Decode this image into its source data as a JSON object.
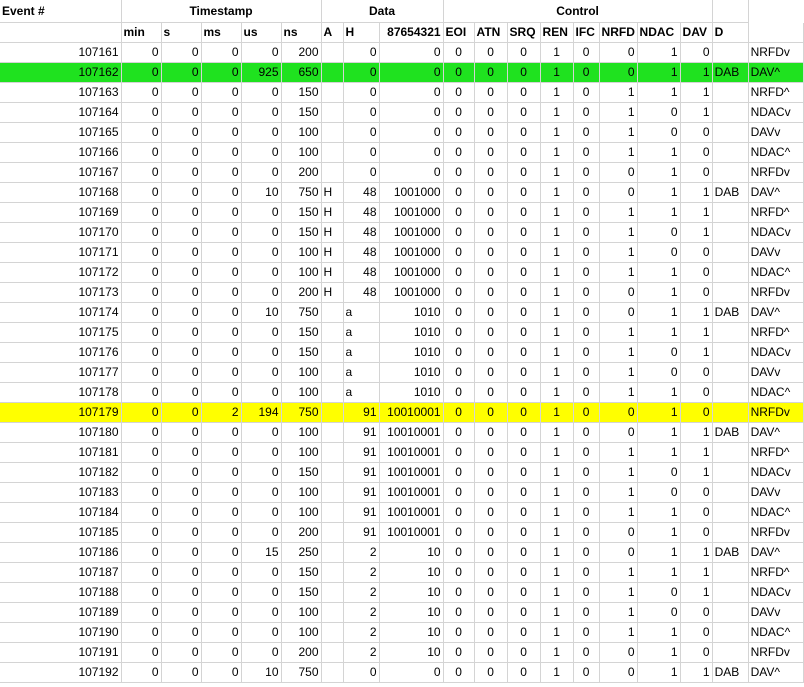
{
  "headers": {
    "event": "Event #",
    "timestamp": "Timestamp",
    "data": "Data",
    "control": "Control",
    "sub": [
      "min",
      "s",
      "ms",
      "us",
      "ns",
      "A",
      "H",
      "87654321",
      "EOI",
      "ATN",
      "SRQ",
      "REN",
      "IFC",
      "NRFD",
      "NDAC",
      "DAV",
      "D",
      ""
    ]
  },
  "colors": {
    "green_highlight": "#1fe21f",
    "yellow_highlight": "#ffff00",
    "gridline": "#d4d4d4"
  },
  "rows": [
    {
      "event": "107161",
      "min": "0",
      "s": "0",
      "ms": "0",
      "us": "0",
      "ns": "200",
      "a": "",
      "h": "0",
      "bits": "0",
      "eoi": "0",
      "atn": "0",
      "srq": "0",
      "ren": "1",
      "ifc": "0",
      "nrfd": "0",
      "ndac": "1",
      "dav": "0",
      "d": "",
      "desc": "NRFDv",
      "hl": ""
    },
    {
      "event": "107162",
      "min": "0",
      "s": "0",
      "ms": "0",
      "us": "925",
      "ns": "650",
      "a": "",
      "h": "0",
      "bits": "0",
      "eoi": "0",
      "atn": "0",
      "srq": "0",
      "ren": "1",
      "ifc": "0",
      "nrfd": "0",
      "ndac": "1",
      "dav": "1",
      "d": "DAB",
      "desc": "DAV^",
      "hl": "green"
    },
    {
      "event": "107163",
      "min": "0",
      "s": "0",
      "ms": "0",
      "us": "0",
      "ns": "150",
      "a": "",
      "h": "0",
      "bits": "0",
      "eoi": "0",
      "atn": "0",
      "srq": "0",
      "ren": "1",
      "ifc": "0",
      "nrfd": "1",
      "ndac": "1",
      "dav": "1",
      "d": "",
      "desc": "NRFD^",
      "hl": ""
    },
    {
      "event": "107164",
      "min": "0",
      "s": "0",
      "ms": "0",
      "us": "0",
      "ns": "150",
      "a": "",
      "h": "0",
      "bits": "0",
      "eoi": "0",
      "atn": "0",
      "srq": "0",
      "ren": "1",
      "ifc": "0",
      "nrfd": "1",
      "ndac": "0",
      "dav": "1",
      "d": "",
      "desc": "NDACv",
      "hl": ""
    },
    {
      "event": "107165",
      "min": "0",
      "s": "0",
      "ms": "0",
      "us": "0",
      "ns": "100",
      "a": "",
      "h": "0",
      "bits": "0",
      "eoi": "0",
      "atn": "0",
      "srq": "0",
      "ren": "1",
      "ifc": "0",
      "nrfd": "1",
      "ndac": "0",
      "dav": "0",
      "d": "",
      "desc": "DAVv",
      "hl": ""
    },
    {
      "event": "107166",
      "min": "0",
      "s": "0",
      "ms": "0",
      "us": "0",
      "ns": "100",
      "a": "",
      "h": "0",
      "bits": "0",
      "eoi": "0",
      "atn": "0",
      "srq": "0",
      "ren": "1",
      "ifc": "0",
      "nrfd": "1",
      "ndac": "1",
      "dav": "0",
      "d": "",
      "desc": "NDAC^",
      "hl": ""
    },
    {
      "event": "107167",
      "min": "0",
      "s": "0",
      "ms": "0",
      "us": "0",
      "ns": "200",
      "a": "",
      "h": "0",
      "bits": "0",
      "eoi": "0",
      "atn": "0",
      "srq": "0",
      "ren": "1",
      "ifc": "0",
      "nrfd": "0",
      "ndac": "1",
      "dav": "0",
      "d": "",
      "desc": "NRFDv",
      "hl": ""
    },
    {
      "event": "107168",
      "min": "0",
      "s": "0",
      "ms": "0",
      "us": "10",
      "ns": "750",
      "a": "H",
      "h": "48",
      "bits": "1001000",
      "eoi": "0",
      "atn": "0",
      "srq": "0",
      "ren": "1",
      "ifc": "0",
      "nrfd": "0",
      "ndac": "1",
      "dav": "1",
      "d": "DAB",
      "desc": "DAV^",
      "hl": ""
    },
    {
      "event": "107169",
      "min": "0",
      "s": "0",
      "ms": "0",
      "us": "0",
      "ns": "150",
      "a": "H",
      "h": "48",
      "bits": "1001000",
      "eoi": "0",
      "atn": "0",
      "srq": "0",
      "ren": "1",
      "ifc": "0",
      "nrfd": "1",
      "ndac": "1",
      "dav": "1",
      "d": "",
      "desc": "NRFD^",
      "hl": ""
    },
    {
      "event": "107170",
      "min": "0",
      "s": "0",
      "ms": "0",
      "us": "0",
      "ns": "150",
      "a": "H",
      "h": "48",
      "bits": "1001000",
      "eoi": "0",
      "atn": "0",
      "srq": "0",
      "ren": "1",
      "ifc": "0",
      "nrfd": "1",
      "ndac": "0",
      "dav": "1",
      "d": "",
      "desc": "NDACv",
      "hl": ""
    },
    {
      "event": "107171",
      "min": "0",
      "s": "0",
      "ms": "0",
      "us": "0",
      "ns": "100",
      "a": "H",
      "h": "48",
      "bits": "1001000",
      "eoi": "0",
      "atn": "0",
      "srq": "0",
      "ren": "1",
      "ifc": "0",
      "nrfd": "1",
      "ndac": "0",
      "dav": "0",
      "d": "",
      "desc": "DAVv",
      "hl": ""
    },
    {
      "event": "107172",
      "min": "0",
      "s": "0",
      "ms": "0",
      "us": "0",
      "ns": "100",
      "a": "H",
      "h": "48",
      "bits": "1001000",
      "eoi": "0",
      "atn": "0",
      "srq": "0",
      "ren": "1",
      "ifc": "0",
      "nrfd": "1",
      "ndac": "1",
      "dav": "0",
      "d": "",
      "desc": "NDAC^",
      "hl": ""
    },
    {
      "event": "107173",
      "min": "0",
      "s": "0",
      "ms": "0",
      "us": "0",
      "ns": "200",
      "a": "H",
      "h": "48",
      "bits": "1001000",
      "eoi": "0",
      "atn": "0",
      "srq": "0",
      "ren": "1",
      "ifc": "0",
      "nrfd": "0",
      "ndac": "1",
      "dav": "0",
      "d": "",
      "desc": "NRFDv",
      "hl": ""
    },
    {
      "event": "107174",
      "min": "0",
      "s": "0",
      "ms": "0",
      "us": "10",
      "ns": "750",
      "a": "",
      "h": "a",
      "bits": "1010",
      "eoi": "0",
      "atn": "0",
      "srq": "0",
      "ren": "1",
      "ifc": "0",
      "nrfd": "0",
      "ndac": "1",
      "dav": "1",
      "d": "DAB",
      "desc": "DAV^",
      "hl": ""
    },
    {
      "event": "107175",
      "min": "0",
      "s": "0",
      "ms": "0",
      "us": "0",
      "ns": "150",
      "a": "",
      "h": "a",
      "bits": "1010",
      "eoi": "0",
      "atn": "0",
      "srq": "0",
      "ren": "1",
      "ifc": "0",
      "nrfd": "1",
      "ndac": "1",
      "dav": "1",
      "d": "",
      "desc": "NRFD^",
      "hl": ""
    },
    {
      "event": "107176",
      "min": "0",
      "s": "0",
      "ms": "0",
      "us": "0",
      "ns": "150",
      "a": "",
      "h": "a",
      "bits": "1010",
      "eoi": "0",
      "atn": "0",
      "srq": "0",
      "ren": "1",
      "ifc": "0",
      "nrfd": "1",
      "ndac": "0",
      "dav": "1",
      "d": "",
      "desc": "NDACv",
      "hl": ""
    },
    {
      "event": "107177",
      "min": "0",
      "s": "0",
      "ms": "0",
      "us": "0",
      "ns": "100",
      "a": "",
      "h": "a",
      "bits": "1010",
      "eoi": "0",
      "atn": "0",
      "srq": "0",
      "ren": "1",
      "ifc": "0",
      "nrfd": "1",
      "ndac": "0",
      "dav": "0",
      "d": "",
      "desc": "DAVv",
      "hl": ""
    },
    {
      "event": "107178",
      "min": "0",
      "s": "0",
      "ms": "0",
      "us": "0",
      "ns": "100",
      "a": "",
      "h": "a",
      "bits": "1010",
      "eoi": "0",
      "atn": "0",
      "srq": "0",
      "ren": "1",
      "ifc": "0",
      "nrfd": "1",
      "ndac": "1",
      "dav": "0",
      "d": "",
      "desc": "NDAC^",
      "hl": ""
    },
    {
      "event": "107179",
      "min": "0",
      "s": "0",
      "ms": "2",
      "us": "194",
      "ns": "750",
      "a": "",
      "h": "91",
      "bits": "10010001",
      "eoi": "0",
      "atn": "0",
      "srq": "0",
      "ren": "1",
      "ifc": "0",
      "nrfd": "0",
      "ndac": "1",
      "dav": "0",
      "d": "",
      "desc": "NRFDv",
      "hl": "yellow"
    },
    {
      "event": "107180",
      "min": "0",
      "s": "0",
      "ms": "0",
      "us": "0",
      "ns": "100",
      "a": "",
      "h": "91",
      "bits": "10010001",
      "eoi": "0",
      "atn": "0",
      "srq": "0",
      "ren": "1",
      "ifc": "0",
      "nrfd": "0",
      "ndac": "1",
      "dav": "1",
      "d": "DAB",
      "desc": "DAV^",
      "hl": ""
    },
    {
      "event": "107181",
      "min": "0",
      "s": "0",
      "ms": "0",
      "us": "0",
      "ns": "100",
      "a": "",
      "h": "91",
      "bits": "10010001",
      "eoi": "0",
      "atn": "0",
      "srq": "0",
      "ren": "1",
      "ifc": "0",
      "nrfd": "1",
      "ndac": "1",
      "dav": "1",
      "d": "",
      "desc": "NRFD^",
      "hl": ""
    },
    {
      "event": "107182",
      "min": "0",
      "s": "0",
      "ms": "0",
      "us": "0",
      "ns": "150",
      "a": "",
      "h": "91",
      "bits": "10010001",
      "eoi": "0",
      "atn": "0",
      "srq": "0",
      "ren": "1",
      "ifc": "0",
      "nrfd": "1",
      "ndac": "0",
      "dav": "1",
      "d": "",
      "desc": "NDACv",
      "hl": ""
    },
    {
      "event": "107183",
      "min": "0",
      "s": "0",
      "ms": "0",
      "us": "0",
      "ns": "100",
      "a": "",
      "h": "91",
      "bits": "10010001",
      "eoi": "0",
      "atn": "0",
      "srq": "0",
      "ren": "1",
      "ifc": "0",
      "nrfd": "1",
      "ndac": "0",
      "dav": "0",
      "d": "",
      "desc": "DAVv",
      "hl": ""
    },
    {
      "event": "107184",
      "min": "0",
      "s": "0",
      "ms": "0",
      "us": "0",
      "ns": "100",
      "a": "",
      "h": "91",
      "bits": "10010001",
      "eoi": "0",
      "atn": "0",
      "srq": "0",
      "ren": "1",
      "ifc": "0",
      "nrfd": "1",
      "ndac": "1",
      "dav": "0",
      "d": "",
      "desc": "NDAC^",
      "hl": ""
    },
    {
      "event": "107185",
      "min": "0",
      "s": "0",
      "ms": "0",
      "us": "0",
      "ns": "200",
      "a": "",
      "h": "91",
      "bits": "10010001",
      "eoi": "0",
      "atn": "0",
      "srq": "0",
      "ren": "1",
      "ifc": "0",
      "nrfd": "0",
      "ndac": "1",
      "dav": "0",
      "d": "",
      "desc": "NRFDv",
      "hl": ""
    },
    {
      "event": "107186",
      "min": "0",
      "s": "0",
      "ms": "0",
      "us": "15",
      "ns": "250",
      "a": "",
      "h": "2",
      "bits": "10",
      "eoi": "0",
      "atn": "0",
      "srq": "0",
      "ren": "1",
      "ifc": "0",
      "nrfd": "0",
      "ndac": "1",
      "dav": "1",
      "d": "DAB",
      "desc": "DAV^",
      "hl": ""
    },
    {
      "event": "107187",
      "min": "0",
      "s": "0",
      "ms": "0",
      "us": "0",
      "ns": "150",
      "a": "",
      "h": "2",
      "bits": "10",
      "eoi": "0",
      "atn": "0",
      "srq": "0",
      "ren": "1",
      "ifc": "0",
      "nrfd": "1",
      "ndac": "1",
      "dav": "1",
      "d": "",
      "desc": "NRFD^",
      "hl": ""
    },
    {
      "event": "107188",
      "min": "0",
      "s": "0",
      "ms": "0",
      "us": "0",
      "ns": "150",
      "a": "",
      "h": "2",
      "bits": "10",
      "eoi": "0",
      "atn": "0",
      "srq": "0",
      "ren": "1",
      "ifc": "0",
      "nrfd": "1",
      "ndac": "0",
      "dav": "1",
      "d": "",
      "desc": "NDACv",
      "hl": ""
    },
    {
      "event": "107189",
      "min": "0",
      "s": "0",
      "ms": "0",
      "us": "0",
      "ns": "100",
      "a": "",
      "h": "2",
      "bits": "10",
      "eoi": "0",
      "atn": "0",
      "srq": "0",
      "ren": "1",
      "ifc": "0",
      "nrfd": "1",
      "ndac": "0",
      "dav": "0",
      "d": "",
      "desc": "DAVv",
      "hl": ""
    },
    {
      "event": "107190",
      "min": "0",
      "s": "0",
      "ms": "0",
      "us": "0",
      "ns": "100",
      "a": "",
      "h": "2",
      "bits": "10",
      "eoi": "0",
      "atn": "0",
      "srq": "0",
      "ren": "1",
      "ifc": "0",
      "nrfd": "1",
      "ndac": "1",
      "dav": "0",
      "d": "",
      "desc": "NDAC^",
      "hl": ""
    },
    {
      "event": "107191",
      "min": "0",
      "s": "0",
      "ms": "0",
      "us": "0",
      "ns": "200",
      "a": "",
      "h": "2",
      "bits": "10",
      "eoi": "0",
      "atn": "0",
      "srq": "0",
      "ren": "1",
      "ifc": "0",
      "nrfd": "0",
      "ndac": "1",
      "dav": "0",
      "d": "",
      "desc": "NRFDv",
      "hl": ""
    },
    {
      "event": "107192",
      "min": "0",
      "s": "0",
      "ms": "0",
      "us": "10",
      "ns": "750",
      "a": "",
      "h": "0",
      "bits": "0",
      "eoi": "0",
      "atn": "0",
      "srq": "0",
      "ren": "1",
      "ifc": "0",
      "nrfd": "0",
      "ndac": "1",
      "dav": "1",
      "d": "DAB",
      "desc": "DAV^",
      "hl": ""
    }
  ]
}
